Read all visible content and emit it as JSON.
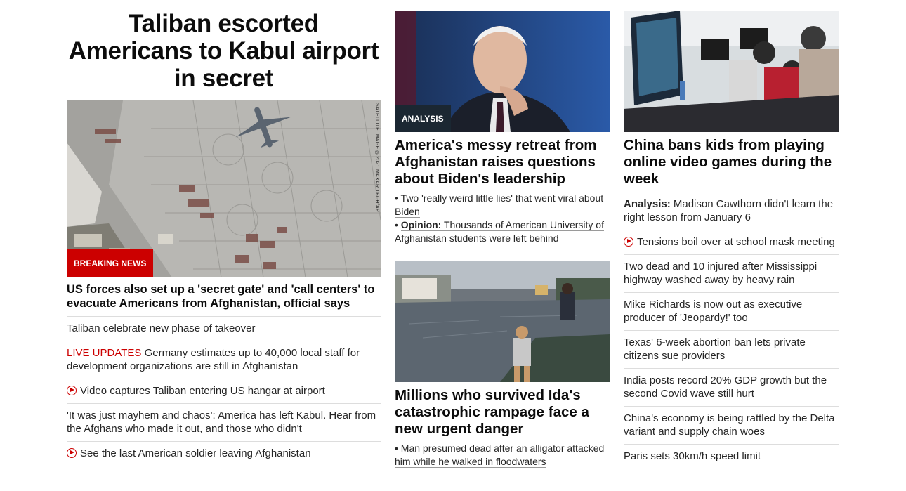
{
  "col1": {
    "headline": "Taliban escorted Americans to Kabul airport in secret",
    "image_credit": "SATELLITE IMAGE ©2021 MAXAR TECH/AP",
    "badge": "BREAKING NEWS",
    "story": "US forces also set up a 'secret gate' and 'call centers' to evacuate Americans from Afghanistan, official says",
    "items": [
      {
        "text": "Taliban celebrate new phase of takeover"
      },
      {
        "prefix": "LIVE UPDATES",
        "text": " Germany estimates up to 40,000 local staff for development organizations are still in Afghanistan"
      },
      {
        "video": true,
        "text": "Video captures Taliban entering US hangar at airport"
      },
      {
        "text": "'It was just mayhem and chaos': America has left Kabul. Hear from the Afghans who made it out, and those who didn't"
      },
      {
        "video": true,
        "text": "See the last American soldier leaving Afghanistan"
      }
    ]
  },
  "col2": {
    "badge": "ANALYSIS",
    "story1": "America's messy retreat from Afghanistan raises questions about Biden's leadership",
    "sub1": [
      {
        "text": "Two 'really weird little lies' that went viral about Biden"
      },
      {
        "prefix": "Opinion:",
        "text": " Thousands of American University of Afghanistan students were left behind"
      }
    ],
    "story2": "Millions who survived Ida's catastrophic rampage face a new urgent danger",
    "sub2": [
      {
        "text": "Man presumed dead after an alligator attacked him while he walked in floodwaters"
      }
    ]
  },
  "col3": {
    "story": "China bans kids from playing online video games during the week",
    "items": [
      {
        "prefix": "Analysis:",
        "text": " Madison Cawthorn didn't learn the right lesson from January 6"
      },
      {
        "video": true,
        "text": "Tensions boil over at school mask meeting"
      },
      {
        "text": "Two dead and 10 injured after Mississippi highway washed away by heavy rain"
      },
      {
        "text": "Mike Richards is now out as executive producer of 'Jeopardy!' too"
      },
      {
        "text": "Texas' 6-week abortion ban lets private citizens sue providers"
      },
      {
        "text": "India posts record 20% GDP growth but the second Covid wave still hurt"
      },
      {
        "text": "China's economy is being rattled by the Delta variant and supply chain woes"
      },
      {
        "text": "Paris sets 30km/h speed limit"
      }
    ]
  }
}
